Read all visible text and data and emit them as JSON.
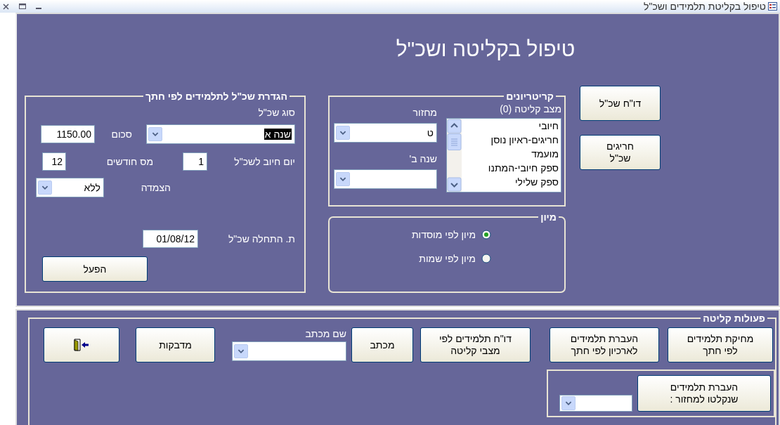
{
  "window": {
    "title": "טיפול בקליטת תלמידים ושכ\"ל"
  },
  "form_title": "טיפול בקליטה ושכ\"ל",
  "side_buttons": [
    {
      "lines": [
        "דו\"ח שכ\"ל"
      ]
    },
    {
      "lines": [
        "חריגים",
        "שכ\"ל"
      ]
    }
  ],
  "criteria": {
    "legend": "קריטריונים",
    "status_label": "מצב קליטה (0)",
    "status_items": [
      {
        "label": "חיובי",
        "selected": false
      },
      {
        "label": "חריגים-ראיון נוסן",
        "selected": false
      },
      {
        "label": "מועמד",
        "selected": false
      },
      {
        "label": "ספק חיובי-המתנו",
        "selected": false
      },
      {
        "label": "ספק שלילי",
        "selected": false
      }
    ],
    "cycle_label": "מחזור",
    "cycle_value": "ט",
    "year_b_label": "שנה ב'"
  },
  "sort": {
    "legend": "מיון",
    "options": [
      {
        "label": "מיון לפי מוסדות",
        "selected": true
      },
      {
        "label": "מיון לפי שמות",
        "selected": false
      }
    ]
  },
  "tuition": {
    "legend": "הגדרת שכ\"ל לתלמידים לפי חתך",
    "type_label": "סוג שכ\"ל",
    "type_value": "שנה א",
    "type_value_highlighted": true,
    "amount_label": "סכום",
    "amount": "1150.00",
    "charge_day_label": "יום חיוב לשכ\"ל",
    "charge_day": "1",
    "months_label": "מס חודשים",
    "months": "12",
    "linkage_label": "הצמדה",
    "linkage": "ללא",
    "start_label": "ת. התחלה שכ\"ל",
    "start": "01/08/12",
    "run_button": "הפעל"
  },
  "actions": {
    "legend": "פעולות קליטה",
    "buttons": [
      {
        "kind": "button",
        "lines": [
          "מחיקת תלמידים",
          "לפי חתך"
        ]
      },
      {
        "kind": "button",
        "lines": [
          "העברת תלמידים",
          "לארכיון לפי חתך"
        ]
      },
      {
        "kind": "button",
        "lines": [
          "דו\"ח  תלמידים לפי",
          "מצבי קליטה"
        ]
      },
      {
        "kind": "button",
        "lines": [
          "מכתב"
        ]
      },
      {
        "kind": "combo",
        "label": "שם מכתב"
      },
      {
        "kind": "button",
        "lines": [
          "מדבקות"
        ]
      },
      {
        "kind": "exit"
      }
    ],
    "transfer_button": {
      "lines": [
        "העברת תלמידים",
        "שנקלטו למחזור :"
      ]
    }
  }
}
